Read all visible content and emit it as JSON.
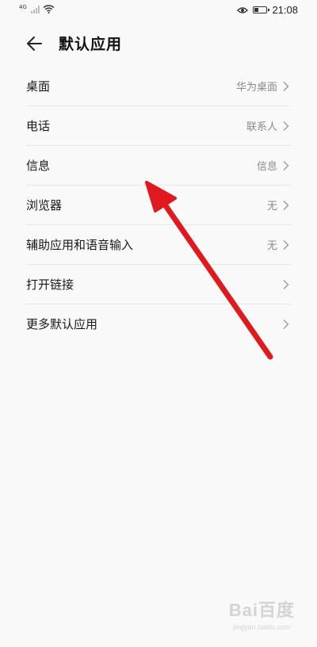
{
  "status_bar": {
    "network_label": "4G",
    "time": "21:08",
    "battery_level": 0.35,
    "icons": [
      "signal-icon",
      "wifi-icon",
      "eye-comfort-icon",
      "battery-icon"
    ]
  },
  "header": {
    "title": "默认应用",
    "back_icon": "arrow-left-icon"
  },
  "settings": {
    "rows": [
      {
        "label": "桌面",
        "value": "华为桌面"
      },
      {
        "label": "电话",
        "value": "联系人"
      },
      {
        "label": "信息",
        "value": "信息"
      },
      {
        "label": "浏览器",
        "value": "无"
      },
      {
        "label": "辅助应用和语音输入",
        "value": "无"
      },
      {
        "label": "打开链接",
        "value": ""
      },
      {
        "label": "更多默认应用",
        "value": ""
      }
    ]
  },
  "annotation": {
    "color": "#e0191e",
    "type": "red-arrow-pointing-to-信息"
  },
  "watermark": {
    "logo": "Bai百度",
    "sub": "jingyan.baidu.com"
  }
}
